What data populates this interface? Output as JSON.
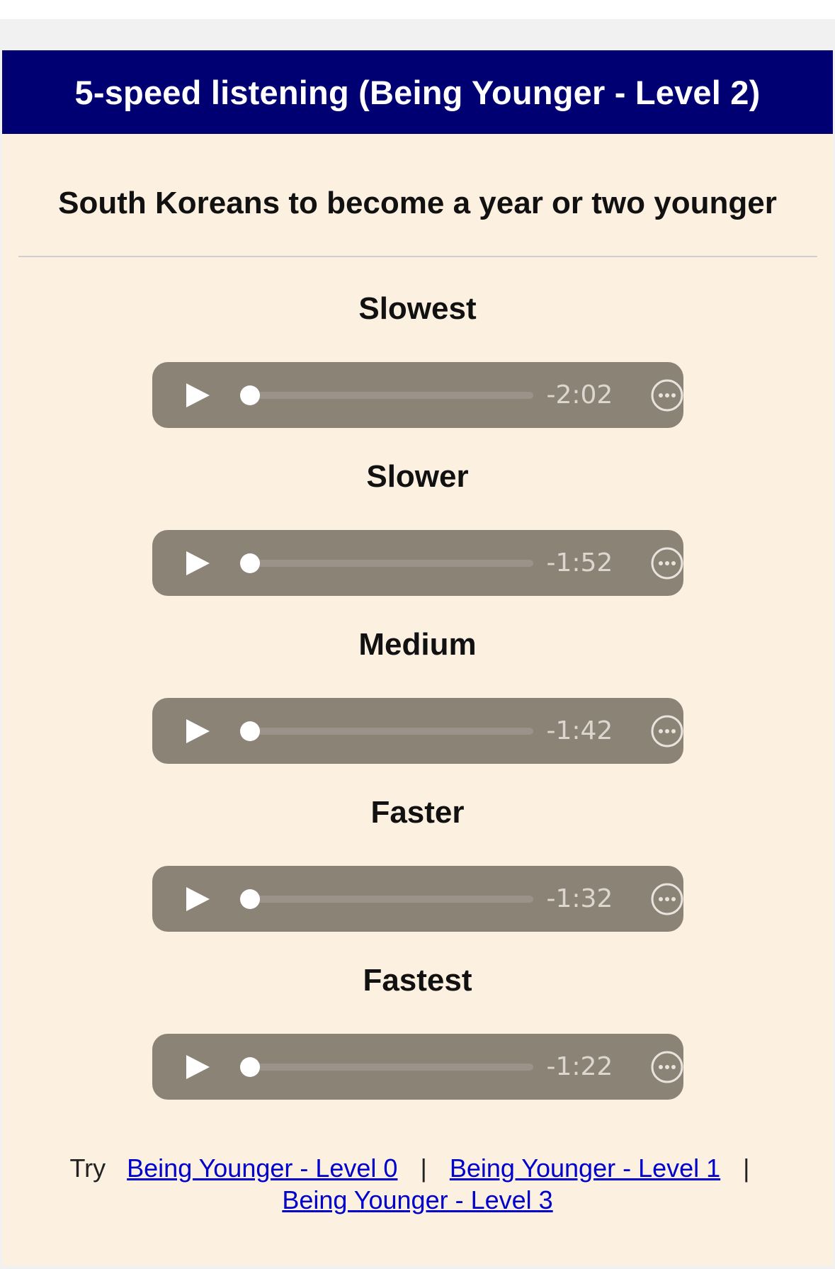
{
  "header": {
    "title": "5-speed listening (Being Younger - Level 2)"
  },
  "subtitle": "South Koreans to become a year or two younger",
  "speeds": [
    {
      "label": "Slowest",
      "time": "-2:02",
      "progress": 0
    },
    {
      "label": "Slower",
      "time": "-1:52",
      "progress": 0
    },
    {
      "label": "Medium",
      "time": "-1:42",
      "progress": 0
    },
    {
      "label": "Faster",
      "time": "-1:32",
      "progress": 0
    },
    {
      "label": "Fastest",
      "time": "-1:22",
      "progress": 0
    }
  ],
  "footer": {
    "try_label": "Try",
    "links": [
      "Being Younger - Level 0",
      "Being Younger - Level 1",
      "Being Younger - Level 3"
    ],
    "separator": "|"
  },
  "colors": {
    "header_bg": "#000073",
    "panel_bg": "#fcf0e0",
    "player_bg": "#8c8377",
    "link": "#0000cc"
  },
  "icons": {
    "play": "play-icon",
    "more": "more-options-icon"
  }
}
